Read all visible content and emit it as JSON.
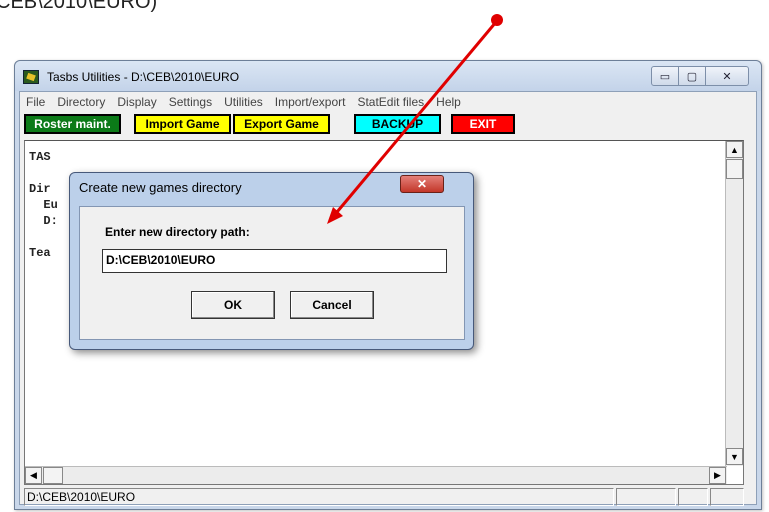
{
  "caption": "CEB\\2010\\EURO)",
  "window": {
    "title": "Tasbs Utilities - D:\\CEB\\2010\\EURO",
    "controls": {
      "minimize": "▭",
      "maximize": "▢",
      "close": "✕"
    }
  },
  "menu": [
    "File",
    "Directory",
    "Display",
    "Settings",
    "Utilities",
    "Import/export",
    "StatEdit files",
    "Help"
  ],
  "toolbar": {
    "roster": "Roster maint.",
    "import": "Import Game",
    "export": "Export Game",
    "backup": "BACKUP",
    "exit": "EXIT"
  },
  "colors": {
    "roster_bg": "#0b7a18",
    "roster_fg": "#ffffff",
    "import_bg": "#ffff00",
    "export_bg": "#ffff00",
    "backup_bg": "#00ffff",
    "exit_bg": "#ff0000",
    "exit_fg": "#ffffff",
    "arrow": "#e00000"
  },
  "content_lines": "TAS\n\nDir\n  Eu\n  D:\n\nTea",
  "statusbar": {
    "path": "D:\\CEB\\2010\\EURO"
  },
  "dialog": {
    "title": "Create new games directory",
    "close": "✕",
    "prompt": "Enter new directory path:",
    "input_value": "D:\\CEB\\2010\\EURO",
    "ok": "OK",
    "cancel": "Cancel"
  },
  "scroll_icons": {
    "up": "▲",
    "down": "▼",
    "left": "◀",
    "right": "▶"
  }
}
